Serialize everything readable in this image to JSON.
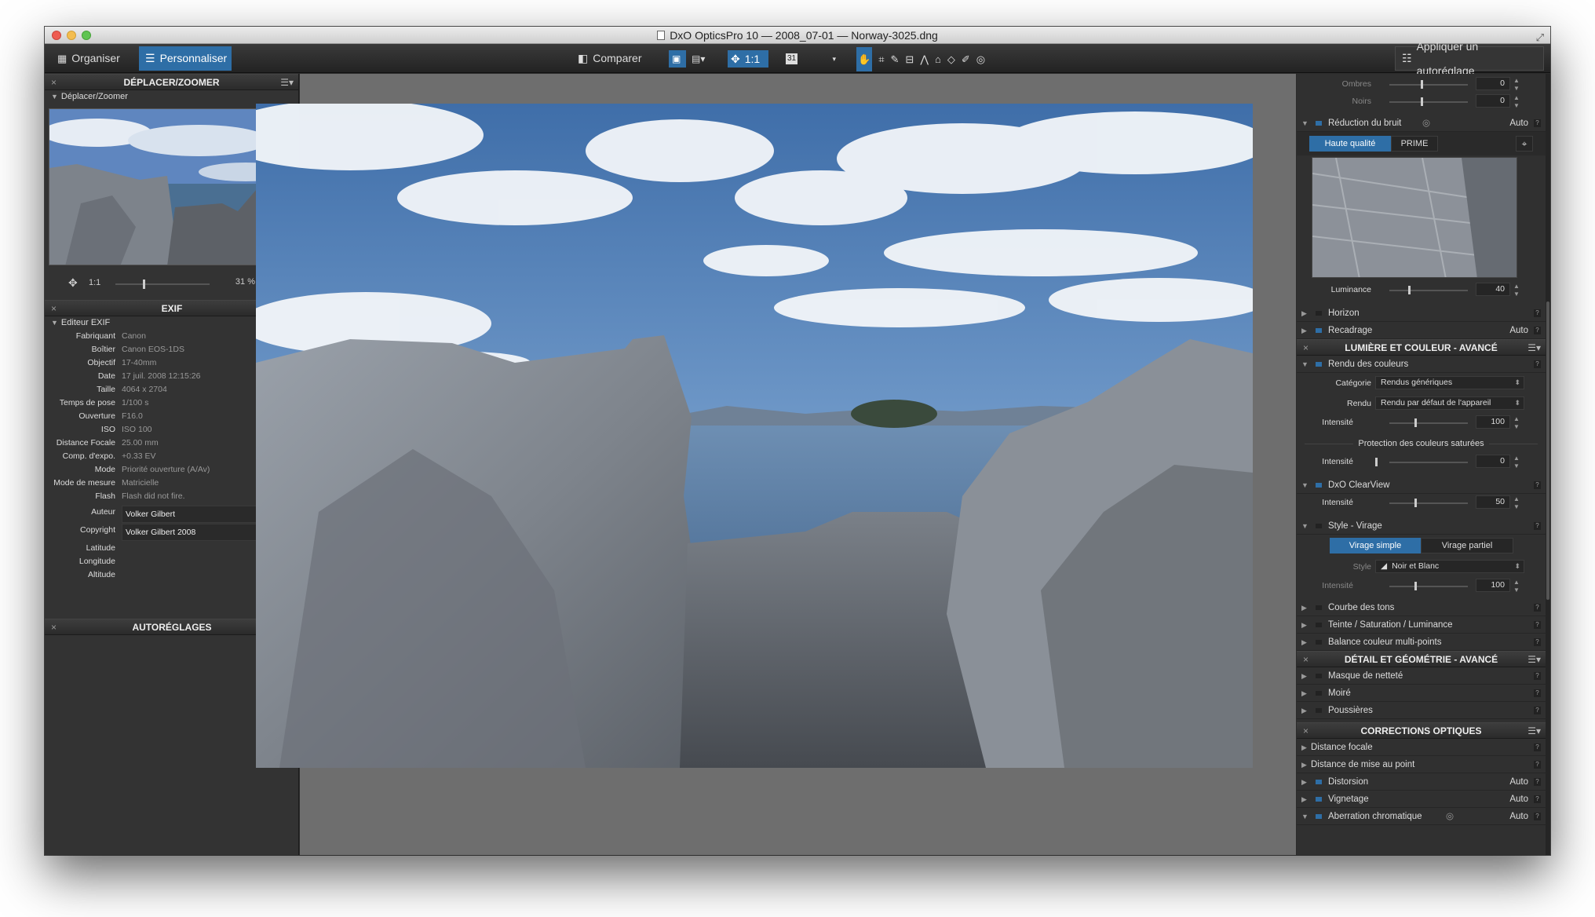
{
  "window": {
    "title": "DxO OpticsPro 10 — 2008_07-01 — Norway-3025.dng"
  },
  "toolbar": {
    "organize": "Organiser",
    "customize": "Personnaliser",
    "compare": "Comparer",
    "zoom": "1:1",
    "apply_preset": "Appliquer un autoréglage"
  },
  "left": {
    "move_zoom": {
      "title": "DÉPLACER/ZOOMER",
      "sub": "Déplacer/Zoomer",
      "ratio": "1:1",
      "percent": "31 %"
    },
    "exif": {
      "title": "EXIF",
      "sub": "Editeur EXIF",
      "rows": [
        {
          "k": "Fabriquant",
          "v": "Canon"
        },
        {
          "k": "Boîtier",
          "v": "Canon EOS-1DS"
        },
        {
          "k": "Objectif",
          "v": "17-40mm"
        },
        {
          "k": "Date",
          "v": "17 juil. 2008 12:15:26"
        },
        {
          "k": "Taille",
          "v": "4064 x 2704"
        },
        {
          "k": "Temps de pose",
          "v": "1/100 s"
        },
        {
          "k": "Ouverture",
          "v": "F16.0"
        },
        {
          "k": "ISO",
          "v": "ISO 100"
        },
        {
          "k": "Distance Focale",
          "v": "25.00 mm"
        },
        {
          "k": "Comp. d'expo.",
          "v": "+0.33 EV"
        },
        {
          "k": "Mode",
          "v": "Priorité ouverture (A/Av)"
        },
        {
          "k": "Mode de mesure",
          "v": "Matricielle"
        },
        {
          "k": "Flash",
          "v": "Flash did not fire."
        }
      ],
      "author_label": "Auteur",
      "author": "Volker Gilbert",
      "copyright_label": "Copyright",
      "copyright": "Volker Gilbert 2008",
      "latitude": "Latitude",
      "longitude": "Longitude",
      "altitude": "Altitude"
    },
    "presets": {
      "title": "AUTORÉGLAGES"
    }
  },
  "right": {
    "shadows": {
      "label": "Ombres",
      "value": "0"
    },
    "blacks": {
      "label": "Noirs",
      "value": "0"
    },
    "noise": {
      "label": "Réduction du bruit",
      "auto": "Auto",
      "tab1": "Haute qualité",
      "tab2": "PRIME",
      "lum_label": "Luminance",
      "lum_value": "40"
    },
    "horizon": "Horizon",
    "crop": {
      "label": "Recadrage",
      "auto": "Auto"
    },
    "light_color": {
      "title": "LUMIÈRE ET COULEUR - AVANCÉ",
      "render": "Rendu des couleurs",
      "cat_label": "Catégorie",
      "cat_value": "Rendus génériques",
      "rendu_label": "Rendu",
      "rendu_value": "Rendu par défaut de l'appareil",
      "int_label": "Intensité",
      "int_value": "100",
      "protect": "Protection des couleurs saturées",
      "prot_int_label": "Intensité",
      "prot_int_value": "0"
    },
    "clearview": {
      "label": "DxO ClearView",
      "int_label": "Intensité",
      "int_value": "50"
    },
    "style": {
      "label": "Style - Virage",
      "tab1": "Virage simple",
      "tab2": "Virage partiel",
      "style_label": "Style",
      "style_value": "Noir et Blanc",
      "int_label": "Intensité",
      "int_value": "100"
    },
    "tone_curve": "Courbe des tons",
    "hsl": "Teinte / Saturation / Luminance",
    "multipoint": "Balance couleur multi-points",
    "detail": {
      "title": "DÉTAIL ET GÉOMÉTRIE - AVANCÉ",
      "unsharp": "Masque de netteté",
      "moire": "Moiré",
      "dust": "Poussières"
    },
    "optics": {
      "title": "CORRECTIONS OPTIQUES",
      "focal": "Distance focale",
      "focus": "Distance de mise au point",
      "distortion": "Distorsion",
      "vignetting": "Vignetage",
      "chromatic": "Aberration chromatique",
      "auto": "Auto"
    }
  }
}
